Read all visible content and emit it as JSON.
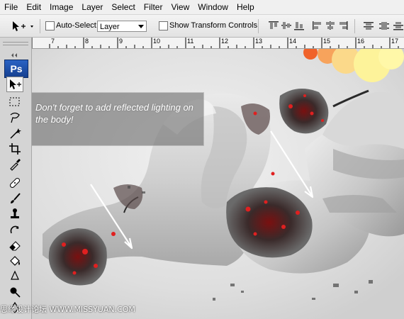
{
  "menu": [
    "File",
    "Edit",
    "Image",
    "Layer",
    "Select",
    "Filter",
    "View",
    "Window",
    "Help"
  ],
  "options": {
    "auto_select_label": "Auto-Select:",
    "auto_select_value": "Layer",
    "transform_label": "Show Transform Controls"
  },
  "toolbar": {
    "logo": "Ps"
  },
  "ruler": {
    "ticks": [
      "7",
      "8",
      "9",
      "10",
      "11",
      "12",
      "13",
      "14",
      "15",
      "16",
      "17"
    ]
  },
  "annotation": {
    "text": "Don't forget to add reflected lighting on the body!"
  },
  "watermark": "思缘设计论坛 WWW.MISSYUAN.COM"
}
